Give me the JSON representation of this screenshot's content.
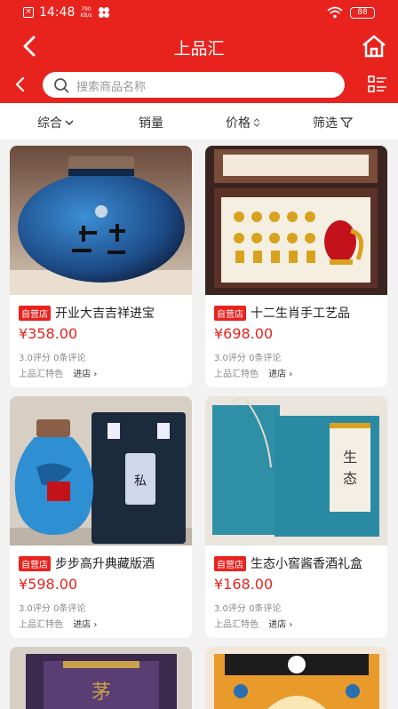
{
  "status": {
    "time": "14:48",
    "speed_value": "790",
    "speed_unit": "KB/s",
    "battery": "88"
  },
  "header": {
    "title": "上品汇"
  },
  "search": {
    "placeholder": "搜索商品名称"
  },
  "filters": [
    "综合",
    "销量",
    "价格",
    "筛选"
  ],
  "products": [
    {
      "badge": "自营店",
      "name": "开业大吉吉祥进宝",
      "price": "¥358.00",
      "rating": "3.0评分",
      "reviews": "0条评论",
      "shop": "上品汇特色",
      "enter": "进店"
    },
    {
      "badge": "自营店",
      "name": "十二生肖手工艺品",
      "price": "¥698.00",
      "rating": "3.0评分",
      "reviews": "0条评论",
      "shop": "上品汇特色",
      "enter": "进店"
    },
    {
      "badge": "自营店",
      "name": "步步高升典藏版酒",
      "price": "¥598.00",
      "rating": "3.0评分",
      "reviews": "0条评论",
      "shop": "上品汇特色",
      "enter": "进店"
    },
    {
      "badge": "自营店",
      "name": "生态小窖酱香酒礼盒",
      "price": "¥168.00",
      "rating": "3.0评分",
      "reviews": "0条评论",
      "shop": "上品汇特色",
      "enter": "进店"
    }
  ],
  "colors": {
    "brand": "#e8231e"
  }
}
